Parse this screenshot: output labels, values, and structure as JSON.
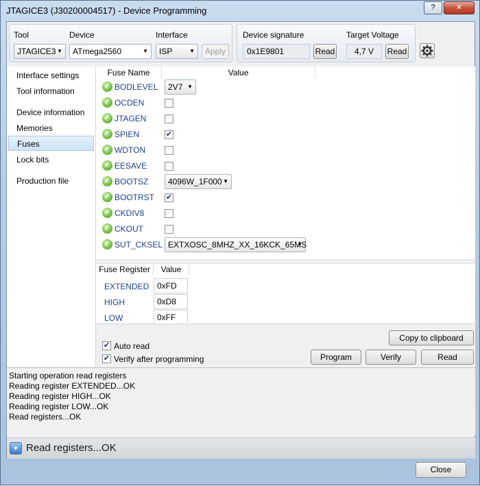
{
  "window": {
    "title": "JTAGICE3 (J30200004517) - Device Programming",
    "help_label": "?",
    "close_symbol": "✕"
  },
  "toolbar": {
    "tool_label": "Tool",
    "tool_value": "JTAGICE3",
    "device_label": "Device",
    "device_value": "ATmega2560",
    "interface_label": "Interface",
    "interface_value": "ISP",
    "apply_label": "Apply",
    "signature_label": "Device signature",
    "signature_value": "0x1E9801",
    "signature_read_label": "Read",
    "voltage_label": "Target Voltage",
    "voltage_value": "4,7 V",
    "voltage_read_label": "Read",
    "settings_icon": "gear-icon"
  },
  "nav": {
    "items": [
      {
        "label": "Interface settings"
      },
      {
        "label": "Tool information"
      },
      {
        "label": "Device information"
      },
      {
        "label": "Memories"
      },
      {
        "label": "Fuses",
        "selected": true
      },
      {
        "label": "Lock bits"
      },
      {
        "label": "Production file"
      }
    ]
  },
  "fuses": {
    "col_name": "Fuse Name",
    "col_value": "Value",
    "rows": [
      {
        "name": "BODLEVEL",
        "type": "select",
        "value": "2V7"
      },
      {
        "name": "OCDEN",
        "type": "checkbox",
        "checked": false
      },
      {
        "name": "JTAGEN",
        "type": "checkbox",
        "checked": false
      },
      {
        "name": "SPIEN",
        "type": "checkbox",
        "checked": true
      },
      {
        "name": "WDTON",
        "type": "checkbox",
        "checked": false
      },
      {
        "name": "EESAVE",
        "type": "checkbox",
        "checked": false
      },
      {
        "name": "BOOTSZ",
        "type": "select",
        "value": "4096W_1F000"
      },
      {
        "name": "BOOTRST",
        "type": "checkbox",
        "checked": true
      },
      {
        "name": "CKDIV8",
        "type": "checkbox",
        "checked": false
      },
      {
        "name": "CKOUT",
        "type": "checkbox",
        "checked": false
      },
      {
        "name": "SUT_CKSEL",
        "type": "select",
        "value": "EXTXOSC_8MHZ_XX_16KCK_65MS"
      }
    ]
  },
  "registers": {
    "col_name": "Fuse Register",
    "col_value": "Value",
    "rows": [
      {
        "name": "EXTENDED",
        "value": "0xFD"
      },
      {
        "name": "HIGH",
        "value": "0xD8"
      },
      {
        "name": "LOW",
        "value": "0xFF"
      }
    ]
  },
  "options": {
    "auto_read_label": "Auto read",
    "auto_read_checked": true,
    "verify_label": "Verify after programming",
    "verify_checked": true,
    "copy_label": "Copy to clipboard",
    "program_label": "Program",
    "verify_button_label": "Verify",
    "read_label": "Read"
  },
  "log": {
    "lines": [
      "Starting operation read registers",
      "Reading register EXTENDED...OK",
      "Reading register HIGH...OK",
      "Reading register LOW...OK",
      "Read registers...OK"
    ]
  },
  "status": {
    "text": "Read registers...OK",
    "icon": "chevron-down-icon"
  },
  "footer": {
    "close_label": "Close"
  }
}
